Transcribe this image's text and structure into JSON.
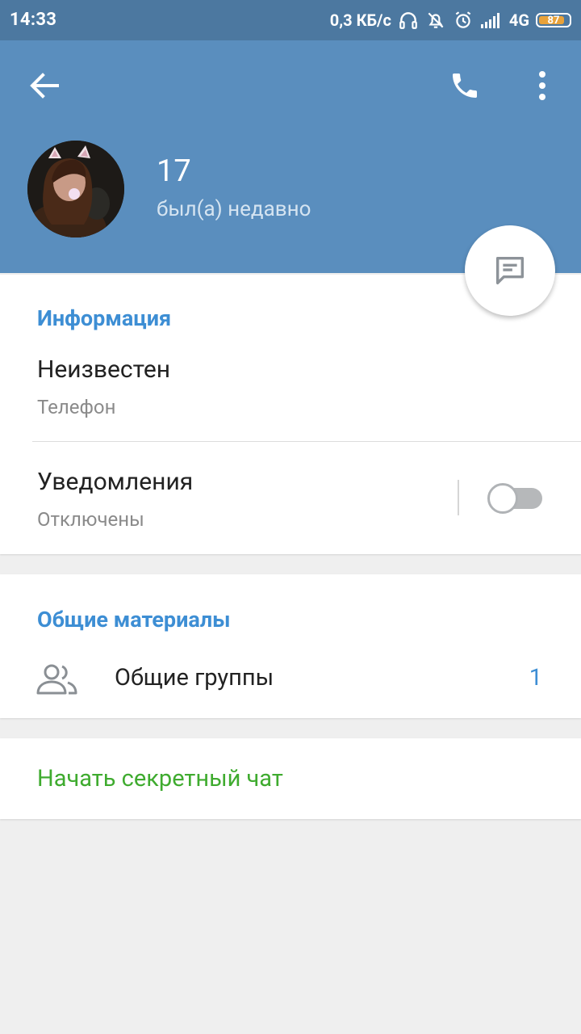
{
  "status_bar": {
    "time": "14:33",
    "net_speed": "0,3 КБ/с",
    "network": "4G",
    "battery": "87",
    "battery_level": 0.87,
    "icons": [
      "headphones-icon",
      "muted-bell-icon",
      "alarm-icon",
      "signal-icon"
    ]
  },
  "header": {
    "back_icon": "arrow-left-icon",
    "call_icon": "phone-icon",
    "menu_icon": "more-vertical-icon",
    "name": "17",
    "last_seen": "был(а) недавно",
    "fab_icon": "message-icon"
  },
  "info": {
    "title": "Информация",
    "phone_value": "Неизвестен",
    "phone_label": "Телефон",
    "notifications_label": "Уведомления",
    "notifications_state": "Отключены",
    "notifications_enabled": false
  },
  "shared": {
    "title": "Общие материалы",
    "groups_icon": "group-icon",
    "groups_label": "Общие группы",
    "groups_count": "1"
  },
  "secret_chat": {
    "label": "Начать секретный чат"
  },
  "colors": {
    "status_bar": "#4c78a0",
    "header": "#5a8ebe",
    "accent_blue": "#3d8ed4",
    "accent_green": "#3fab2f",
    "background": "#efefef"
  }
}
